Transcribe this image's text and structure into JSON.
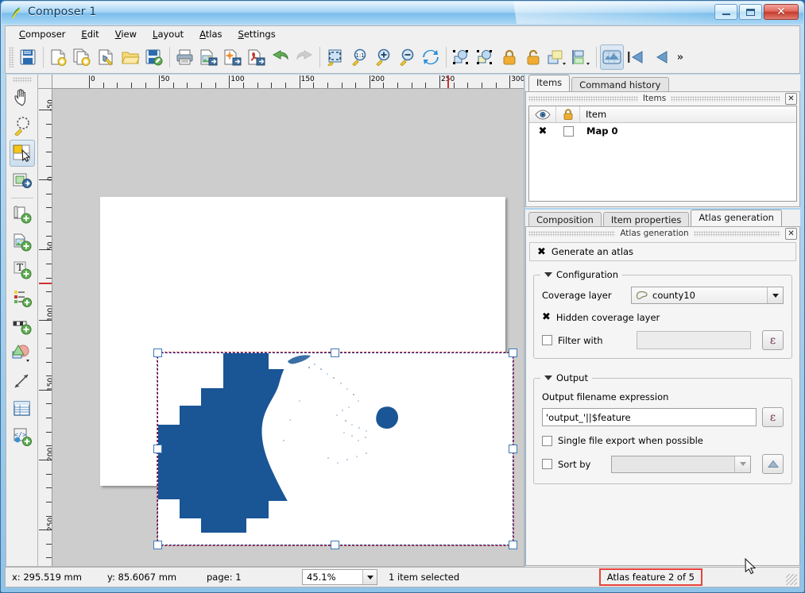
{
  "window": {
    "title": "Composer 1",
    "icon": "qgis-composer-icon",
    "controls": {
      "minimize": "minimize-button",
      "maximize": "maximize-button",
      "close": "close-button"
    }
  },
  "menubar": {
    "items": [
      {
        "label": "Composer",
        "accel": "C"
      },
      {
        "label": "Edit",
        "accel": "E"
      },
      {
        "label": "View",
        "accel": "V"
      },
      {
        "label": "Layout",
        "accel": "L"
      },
      {
        "label": "Atlas",
        "accel": "A"
      },
      {
        "label": "Settings",
        "accel": "S"
      }
    ]
  },
  "toolbar": {
    "groups": [
      {
        "buttons": [
          {
            "name": "save-project-icon",
            "tip": "Save Project"
          }
        ]
      },
      {
        "buttons": [
          {
            "name": "new-composer-icon",
            "tip": "New Composer"
          },
          {
            "name": "duplicate-composer-icon",
            "tip": "Duplicate Composer"
          },
          {
            "name": "composer-manager-icon",
            "tip": "Composer Manager"
          },
          {
            "name": "load-template-icon",
            "tip": "Load from template"
          },
          {
            "name": "save-template-icon",
            "tip": "Save as template"
          }
        ]
      },
      {
        "buttons": [
          {
            "name": "print-icon",
            "tip": "Print"
          },
          {
            "name": "export-image-icon",
            "tip": "Export as Image"
          },
          {
            "name": "export-svg-icon",
            "tip": "Export as SVG"
          },
          {
            "name": "export-pdf-icon",
            "tip": "Export as PDF"
          },
          {
            "name": "undo-icon",
            "tip": "Undo"
          },
          {
            "name": "redo-icon",
            "tip": "Redo",
            "disabled": true
          }
        ]
      },
      {
        "buttons": [
          {
            "name": "zoom-full-icon",
            "tip": "Zoom full"
          },
          {
            "name": "zoom-actual-size-icon",
            "tip": "Zoom to 100%"
          },
          {
            "name": "zoom-in-icon",
            "tip": "Zoom in"
          },
          {
            "name": "zoom-out-icon",
            "tip": "Zoom out"
          },
          {
            "name": "refresh-view-icon",
            "tip": "Refresh view"
          }
        ]
      },
      {
        "buttons": [
          {
            "name": "select-all-icon",
            "tip": "Select all items"
          },
          {
            "name": "deselect-all-icon",
            "tip": "Deselect all items"
          },
          {
            "name": "lock-items-icon",
            "tip": "Lock selected items"
          },
          {
            "name": "unlock-items-icon",
            "tip": "Unlock all items"
          },
          {
            "name": "raise-items-icon",
            "tip": "Raise selected items"
          },
          {
            "name": "align-items-icon",
            "tip": "Align selected items"
          }
        ]
      },
      {
        "buttons": [
          {
            "name": "atlas-preview-icon",
            "tip": "Preview Atlas",
            "pressed": true
          },
          {
            "name": "atlas-first-feature-icon",
            "tip": "First feature"
          },
          {
            "name": "atlas-previous-feature-icon",
            "tip": "Previous feature"
          }
        ]
      }
    ],
    "overflow_label": "»"
  },
  "lefttoolbar": {
    "tools": [
      {
        "name": "pan-tool",
        "label": "Pan layout"
      },
      {
        "name": "zoom-tool",
        "label": "Zoom"
      },
      {
        "name": "select-move-item-tool",
        "label": "Select/Move item",
        "active": true
      },
      {
        "name": "move-item-content-tool",
        "label": "Move item content"
      },
      {
        "name": "add-map-tool",
        "label": "Add new map"
      },
      {
        "name": "add-image-tool",
        "label": "Add image"
      },
      {
        "name": "add-label-tool",
        "label": "Add new label"
      },
      {
        "name": "add-legend-tool",
        "label": "Add new legend"
      },
      {
        "name": "add-scalebar-tool",
        "label": "Add new scalebar"
      },
      {
        "name": "add-shape-tool",
        "label": "Add shape"
      },
      {
        "name": "add-arrow-tool",
        "label": "Add arrow"
      },
      {
        "name": "add-table-tool",
        "label": "Add attribute table"
      },
      {
        "name": "add-html-frame-tool",
        "label": "Add HTML frame"
      }
    ]
  },
  "canvas": {
    "hruler": {
      "labels": [
        "0",
        "50",
        "100",
        "150",
        "200",
        "250",
        "300"
      ],
      "unit": "mm"
    },
    "vruler": {
      "labels": [
        "-50",
        "0",
        "50",
        "100",
        "150",
        "200",
        "250"
      ],
      "unit": "mm"
    },
    "map_item": {
      "name": "Map 0",
      "selected": true,
      "fill_color": "#1a5596",
      "background": "#ffffff"
    }
  },
  "items_panel": {
    "tabs": [
      {
        "label": "Items",
        "active": true
      },
      {
        "label": "Command history",
        "active": false
      }
    ],
    "title": "Items",
    "close_label": "✕",
    "columns": [
      "visibility-column",
      "lock-column",
      "Item"
    ],
    "rows": [
      {
        "name": "Map 0",
        "visible": true,
        "visible_mark": "✖",
        "locked": false
      }
    ]
  },
  "properties_panel": {
    "tabs": [
      {
        "label": "Composition",
        "active": false
      },
      {
        "label": "Item properties",
        "active": false
      },
      {
        "label": "Atlas generation",
        "active": true
      }
    ],
    "title": "Atlas generation",
    "close_label": "✕",
    "generate_atlas": {
      "label": "Generate an atlas",
      "checked": true,
      "mark": "✖"
    },
    "configuration": {
      "title": "Configuration",
      "coverage_layer": {
        "label": "Coverage layer",
        "value": "county10",
        "icon": "polygon-layer-icon"
      },
      "hidden_coverage_layer": {
        "label": "Hidden coverage layer",
        "checked": true,
        "mark": "✖"
      },
      "filter_with": {
        "label": "Filter with",
        "checked": false,
        "value": "",
        "expression_button": "ε"
      }
    },
    "output": {
      "title": "Output",
      "filename_expression_label": "Output filename expression",
      "filename_expression_value": "'output_'||$feature",
      "filename_expression_button": "ε",
      "single_file_export": {
        "label": "Single file export when possible",
        "checked": false
      },
      "sort_by": {
        "label": "Sort by",
        "checked": false,
        "value": "",
        "direction_button": "sort-ascending-icon"
      }
    }
  },
  "statusbar": {
    "x": "x: 295.519 mm",
    "y": "y: 85.6067 mm",
    "page": "page: 1",
    "zoom": "45.1%",
    "selection": "1 item selected",
    "atlas_feature": "Atlas feature 2 of 5",
    "highlight_color": "#e8433c"
  }
}
